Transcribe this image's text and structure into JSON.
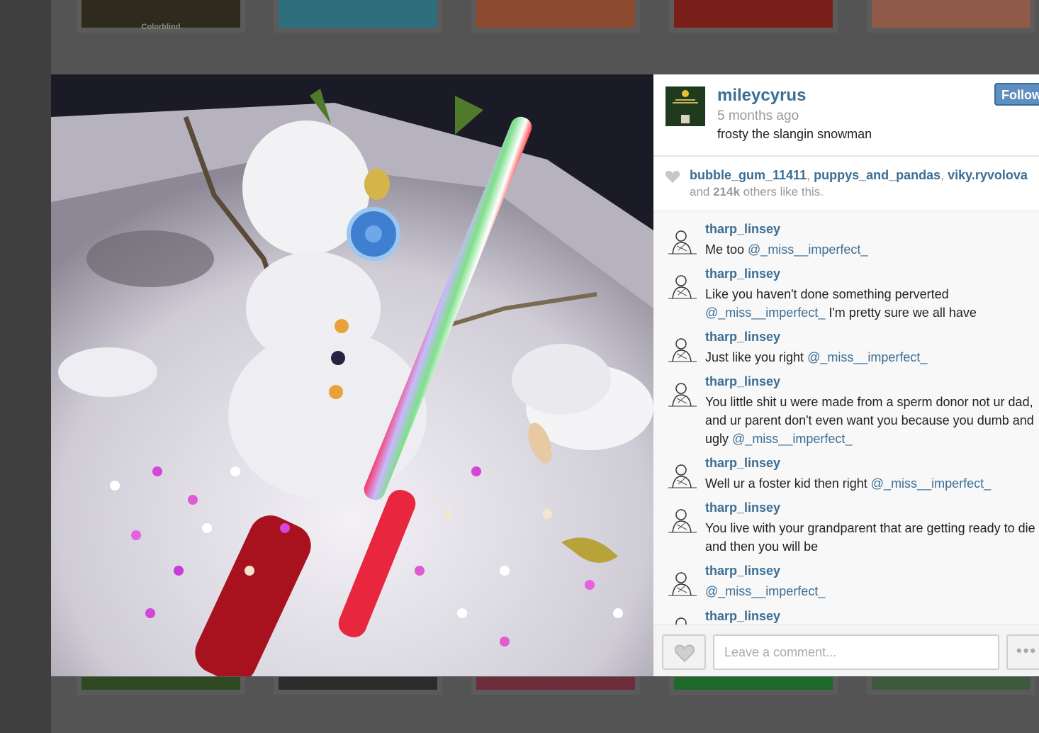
{
  "thumbnail_row_top": {
    "first_caption": "Colorblind"
  },
  "post": {
    "username": "mileycyrus",
    "time_ago": "5 months ago",
    "caption": "frosty the slangin snowman",
    "follow_label": "Follow"
  },
  "likes": {
    "likers": [
      "bubble_gum_11411",
      "puppys_and_pandas",
      "viky.ryvolova"
    ],
    "separator": ", ",
    "and_prefix": "and ",
    "count": "214k",
    "suffix": " others like this."
  },
  "comments": [
    {
      "user": "tharp_linsey",
      "parts": [
        {
          "t": "Me too "
        },
        {
          "m": "@_miss__imperfect_"
        }
      ]
    },
    {
      "user": "tharp_linsey",
      "parts": [
        {
          "t": "Like you haven't done something perverted "
        },
        {
          "m": "@_miss__imperfect_"
        },
        {
          "t": " I'm pretty sure we all have"
        }
      ]
    },
    {
      "user": "tharp_linsey",
      "parts": [
        {
          "t": "Just like you right "
        },
        {
          "m": "@_miss__imperfect_"
        }
      ]
    },
    {
      "user": "tharp_linsey",
      "parts": [
        {
          "t": "You little shit u were made from a sperm donor not ur dad, and ur parent don't even want you because you dumb and ugly "
        },
        {
          "m": "@_miss__imperfect_"
        }
      ]
    },
    {
      "user": "tharp_linsey",
      "parts": [
        {
          "t": "Well ur a foster kid then right "
        },
        {
          "m": "@_miss__imperfect_"
        }
      ]
    },
    {
      "user": "tharp_linsey",
      "parts": [
        {
          "t": "You live with your grandparent that are getting ready to die and then you will be"
        }
      ]
    },
    {
      "user": "tharp_linsey",
      "parts": [
        {
          "m": "@_miss__imperfect_"
        }
      ]
    },
    {
      "user": "tharp_linsey",
      "parts": []
    }
  ],
  "footer": {
    "comment_placeholder": "Leave a comment...",
    "more_label": "•••"
  },
  "icons": {
    "like": "heart-icon",
    "more": "ellipsis-icon"
  },
  "colors": {
    "link": "#3b6e95",
    "follow": "#5f8fbe",
    "overlay": "#4a4a4a"
  }
}
